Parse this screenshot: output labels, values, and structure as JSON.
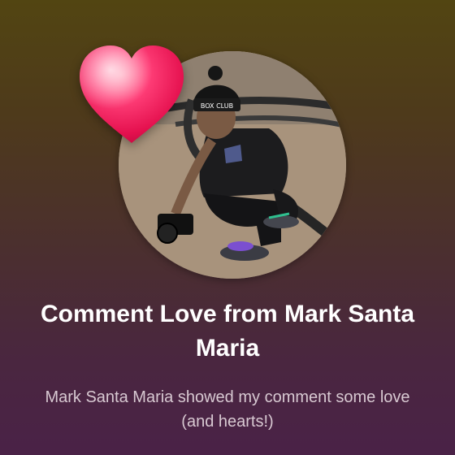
{
  "notification": {
    "title": "Comment Love from Mark Santa Maria",
    "message": "Mark Santa Maria showed my comment some love (and hearts!)",
    "reaction_icon": "heart-icon",
    "avatar_cap_text": "BOX CLUB"
  },
  "colors": {
    "heart": "#ff2d6b",
    "title_text": "#ffffff",
    "message_text": "#d8c9d2",
    "gradient_top": "#524512",
    "gradient_bottom": "#4a2247"
  }
}
